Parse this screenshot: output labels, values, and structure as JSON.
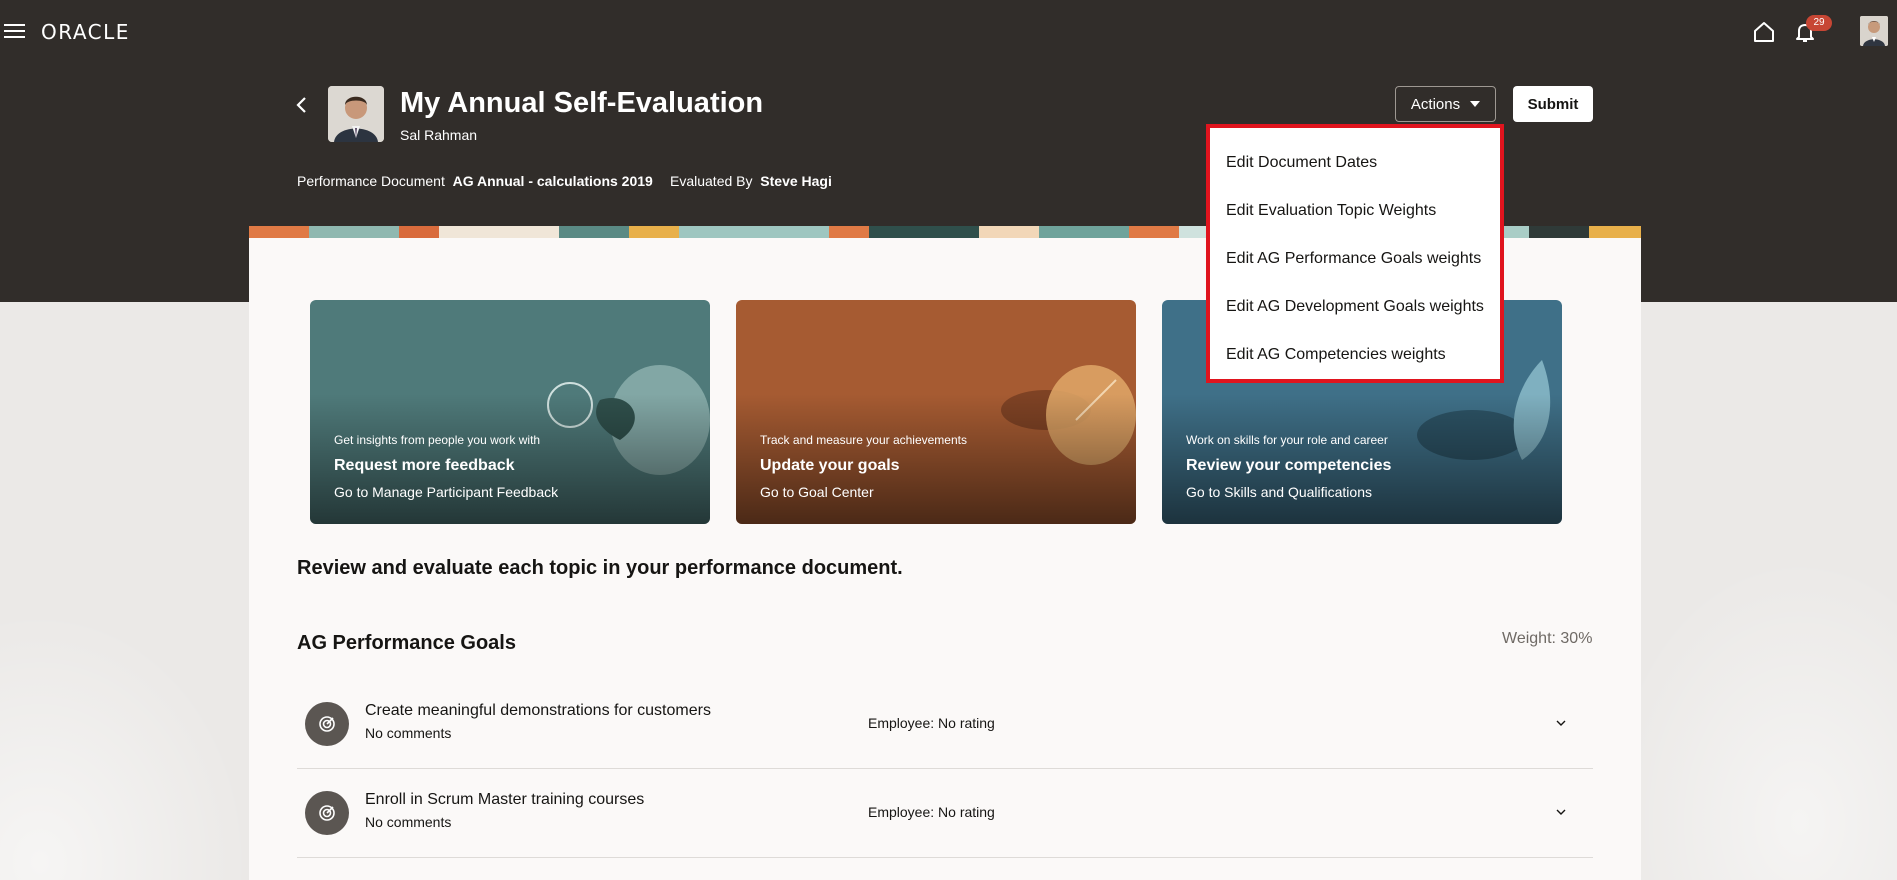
{
  "app": {
    "logo": "ORACLE",
    "notification_count": "29"
  },
  "header": {
    "title": "My Annual Self-Evaluation",
    "person_name": "Sal Rahman",
    "doc_label": "Performance Document",
    "doc_value": "AG Annual - calculations 2019",
    "evaluator_label": "Evaluated By",
    "evaluator_value": "Steve Hagi",
    "actions_label": "Actions",
    "submit_label": "Submit"
  },
  "actions_menu": {
    "items": [
      "Edit Document Dates",
      "Edit Evaluation Topic Weights",
      "Edit AG Performance Goals weights",
      "Edit AG Development Goals weights",
      "Edit AG Competencies weights"
    ]
  },
  "cards": [
    {
      "kicker": "Get insights from people you work with",
      "title": "Request more feedback",
      "link": "Go to Manage Participant Feedback",
      "color": "#4f7a7a"
    },
    {
      "kicker": "Track and measure your achievements",
      "title": "Update your goals",
      "link": "Go to Goal Center",
      "color": "#a65b32"
    },
    {
      "kicker": "Work on skills for your role and career",
      "title": "Review your competencies",
      "link": "Go to Skills and Qualifications",
      "color": "#3f7088"
    }
  ],
  "main": {
    "instructions": "Review and evaluate each topic in your performance document.",
    "section_title": "AG Performance Goals",
    "weight": "Weight: 30%",
    "goals": [
      {
        "title": "Create meaningful demonstrations for customers",
        "comment": "No comments",
        "rating": "Employee: No rating"
      },
      {
        "title": "Enroll in Scrum Master training courses",
        "comment": "No comments",
        "rating": "Employee: No rating"
      }
    ]
  },
  "icons": [
    "hamburger-icon",
    "home-icon",
    "bell-icon",
    "back-icon",
    "caret-down-icon",
    "target-icon",
    "chevron-down-icon"
  ],
  "colors": {
    "header_bg": "#312d2a",
    "accent_red": "#e0141e",
    "badge": "#c74634"
  }
}
